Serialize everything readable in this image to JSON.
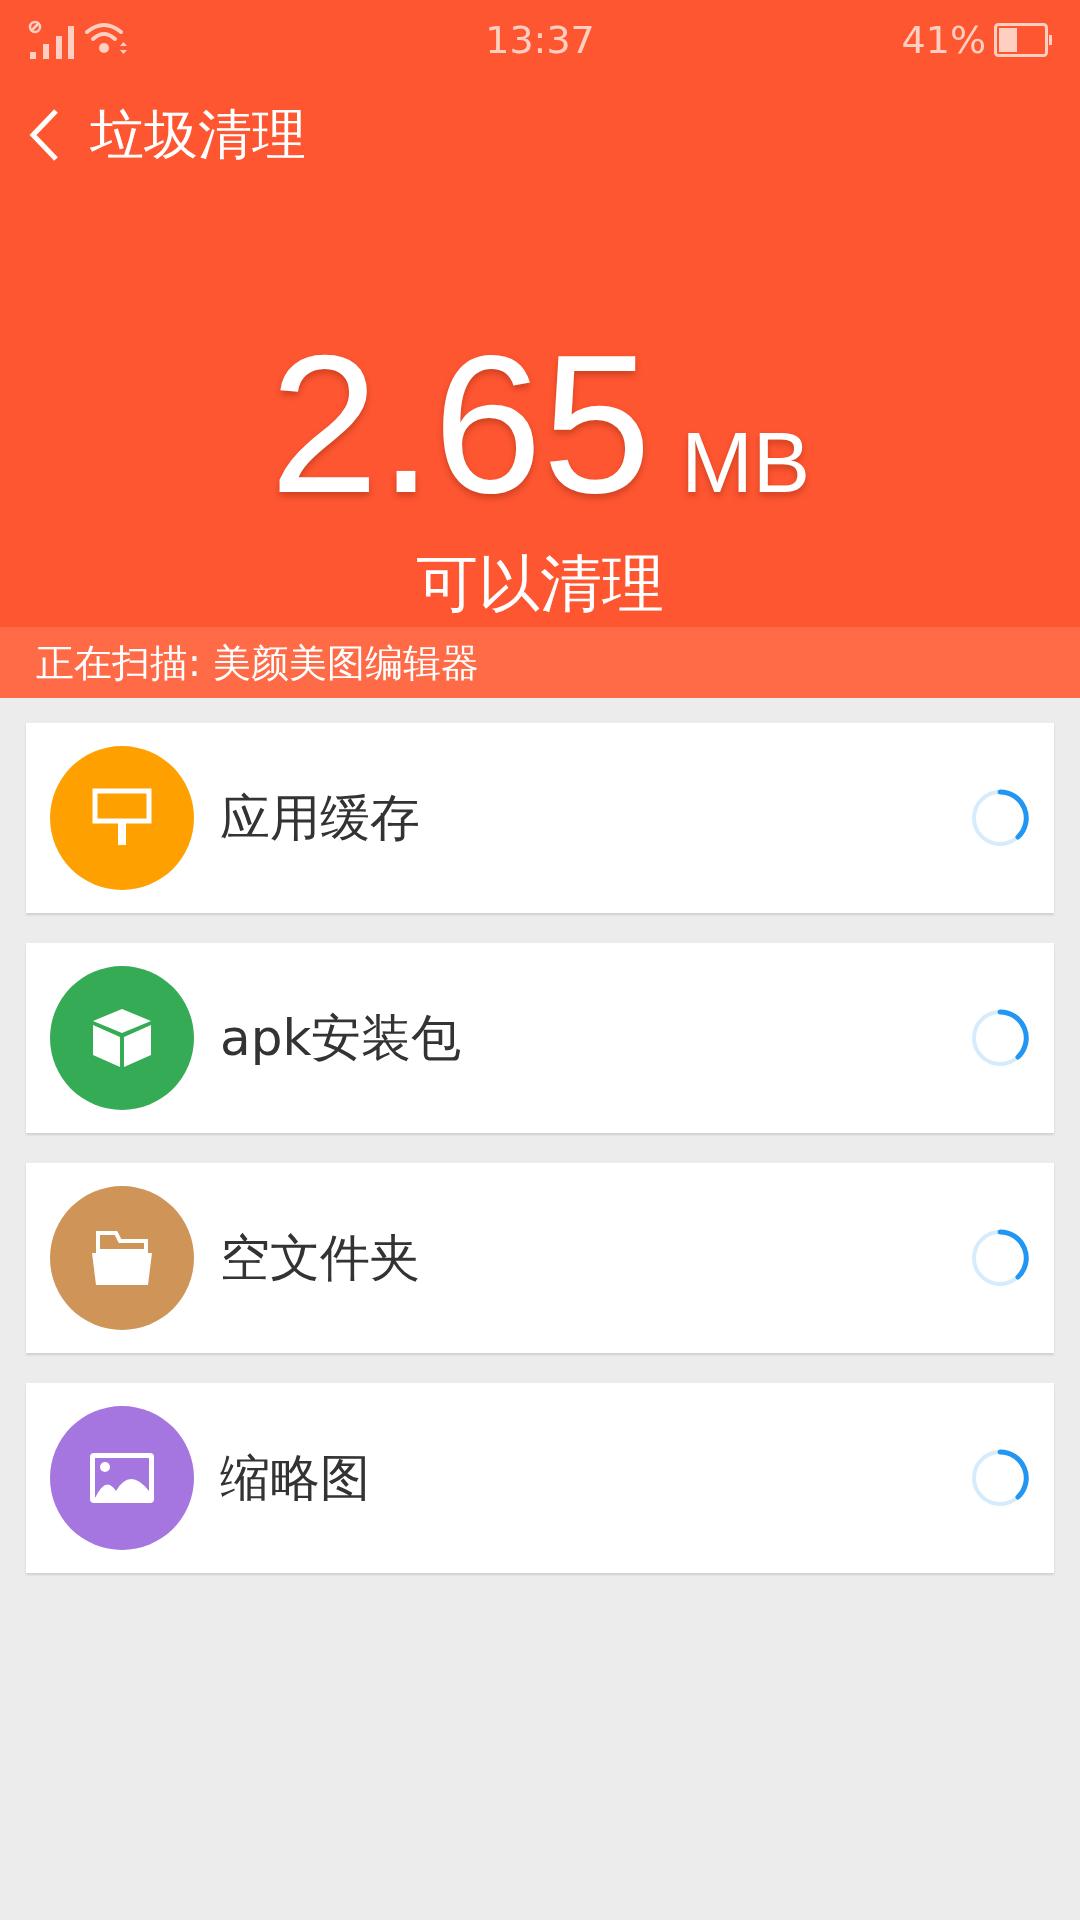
{
  "status_bar": {
    "time": "13:37",
    "battery": "41%"
  },
  "header": {
    "title": "垃圾清理"
  },
  "summary": {
    "amount": "2.65",
    "unit": "MB",
    "caption": "可以清理"
  },
  "scan_status": "正在扫描: 美颜美图编辑器",
  "categories": [
    {
      "label": "应用缓存",
      "kind": "cache",
      "color": "#fea000"
    },
    {
      "label": "apk安装包",
      "kind": "package",
      "color": "#36ab55"
    },
    {
      "label": "空文件夹",
      "kind": "folder",
      "color": "#cf9457"
    },
    {
      "label": "缩略图",
      "kind": "image",
      "color": "#a575e0"
    }
  ]
}
